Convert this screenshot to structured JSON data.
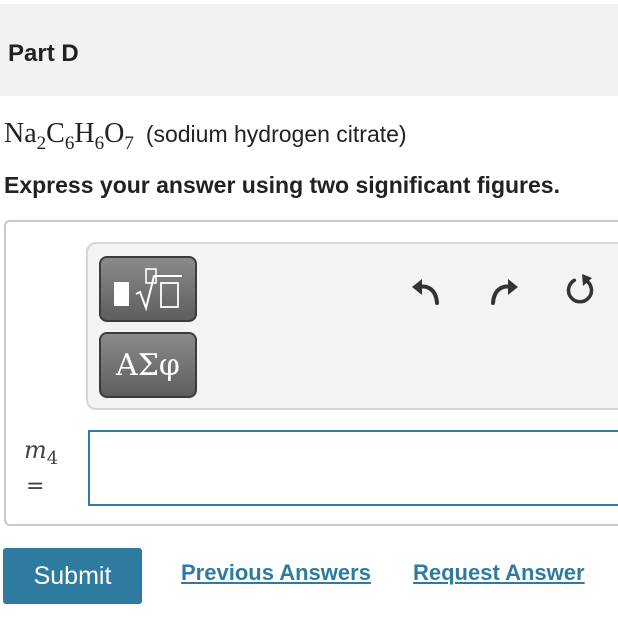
{
  "part": {
    "title": "Part D"
  },
  "question": {
    "formula": [
      {
        "sym": "Na",
        "sub": "2"
      },
      {
        "sym": "C",
        "sub": "6"
      },
      {
        "sym": "H",
        "sub": "6"
      },
      {
        "sym": "O",
        "sub": "7"
      }
    ],
    "formula_desc": "(sodium hydrogen citrate)",
    "instruction": "Express your answer using two significant figures."
  },
  "toolbar": {
    "templates_icon": "templates-sqrt-icon",
    "symbols_label": "ΑΣφ",
    "undo_icon": "undo-icon",
    "redo_icon": "redo-icon",
    "reset_icon": "reset-icon"
  },
  "answer": {
    "variable": "m",
    "variable_sub": "4",
    "equals": "=",
    "value": ""
  },
  "actions": {
    "submit_label": "Submit",
    "previous_answers_label": "Previous Answers",
    "request_answer_label": "Request Answer"
  },
  "colors": {
    "accent": "#2f7b9f",
    "input_border": "#2f7da4",
    "header_bg": "#f2f2f2",
    "tool_button": "#6e6e6e"
  }
}
